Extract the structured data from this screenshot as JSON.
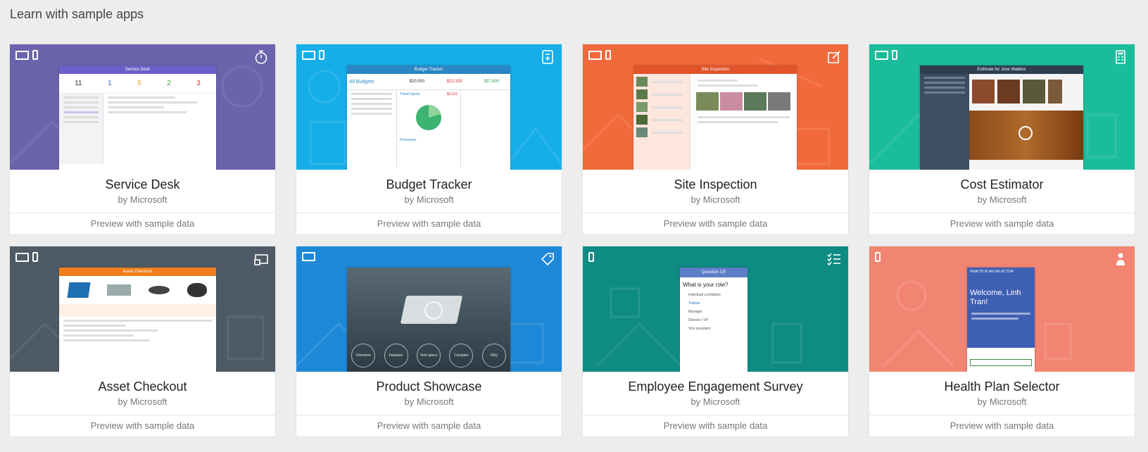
{
  "page": {
    "title": "Learn with sample apps"
  },
  "cards": [
    {
      "name": "Service Desk",
      "author": "by Microsoft",
      "preview": "Preview with sample data",
      "color": "#6c63ad",
      "icon": "stopwatch-icon",
      "devices": [
        "tablet",
        "phone"
      ],
      "screen_title": "Service Desk"
    },
    {
      "name": "Budget Tracker",
      "author": "by Microsoft",
      "preview": "Preview with sample data",
      "color": "#16aee8",
      "icon": "calculator-book-icon",
      "devices": [
        "tablet",
        "phone"
      ],
      "screen_title": "Budget Tracker"
    },
    {
      "name": "Site Inspection",
      "author": "by Microsoft",
      "preview": "Preview with sample data",
      "color": "#f26a3c",
      "icon": "edit-note-icon",
      "devices": [
        "tablet",
        "phone"
      ],
      "screen_title": "Site Inspection"
    },
    {
      "name": "Cost Estimator",
      "author": "by Microsoft",
      "preview": "Preview with sample data",
      "color": "#1bbc9b",
      "icon": "calculator-icon",
      "devices": [
        "tablet",
        "phone"
      ],
      "screen_title": "Estimate for Jose Watkins"
    },
    {
      "name": "Asset Checkout",
      "author": "by Microsoft",
      "preview": "Preview with sample data",
      "color": "#4e5b66",
      "icon": "cast-icon",
      "devices": [
        "tablet",
        "phone"
      ],
      "screen_title": "Asset Checkout"
    },
    {
      "name": "Product Showcase",
      "author": "by Microsoft",
      "preview": "Preview with sample data",
      "color": "#1e88d8",
      "icon": "tag-icon",
      "devices": [
        "tablet"
      ],
      "screen_title": ""
    },
    {
      "name": "Employee Engagement Survey",
      "author": "by Microsoft",
      "preview": "Preview with sample data",
      "color": "#0e8c83",
      "icon": "checklist-icon",
      "devices": [
        "phone"
      ],
      "screen_title": "Question 1/5"
    },
    {
      "name": "Health Plan Selector",
      "author": "by Microsoft",
      "preview": "Preview with sample data",
      "color": "#f28572",
      "icon": "person-add-icon",
      "devices": [
        "phone"
      ],
      "screen_title": "HEALTH PLAN SELECTOR"
    }
  ],
  "mockups": {
    "service_desk": {
      "stats": [
        "11",
        "1",
        "5",
        "2",
        "3"
      ]
    },
    "budget": {
      "header": "All Budgets",
      "amounts": [
        "$20,000",
        "$23,333",
        "$37,600"
      ],
      "section": "Travel Spent",
      "total": "$3,316",
      "processes": "Processes"
    },
    "survey": {
      "question": "What is your role?",
      "options": [
        "Individual contributor",
        "Trainee",
        "Manager",
        "Director / VP",
        "Vice president"
      ]
    },
    "health": {
      "welcome": "Welcome, Linh Tran!"
    },
    "showcase": {
      "tabs": [
        "Overview",
        "Features",
        "Tech specs",
        "Compare",
        "FAQ"
      ]
    }
  }
}
